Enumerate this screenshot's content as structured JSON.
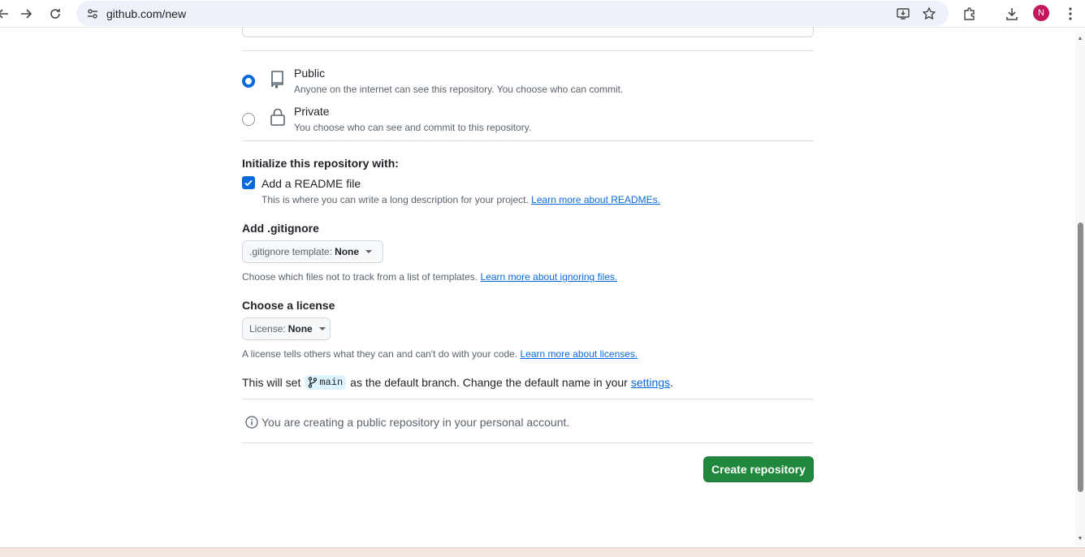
{
  "browser": {
    "url": "github.com/new",
    "avatar_letter": "N"
  },
  "visibility": {
    "public": {
      "title": "Public",
      "description": "Anyone on the internet can see this repository. You choose who can commit.",
      "selected": true
    },
    "private": {
      "title": "Private",
      "description": "You choose who can see and commit to this repository.",
      "selected": false
    }
  },
  "initialize": {
    "heading": "Initialize this repository with:",
    "readme_label": "Add a README file",
    "readme_checked": true,
    "readme_note": "This is where you can write a long description for your project.",
    "readme_link": "Learn more about READMEs."
  },
  "gitignore": {
    "heading": "Add .gitignore",
    "select_prefix": ".gitignore template:",
    "select_value": "None",
    "note": "Choose which files not to track from a list of templates.",
    "link": "Learn more about ignoring files."
  },
  "license": {
    "heading": "Choose a license",
    "select_prefix": "License:",
    "select_value": "None",
    "note": "A license tells others what they can and can't do with your code.",
    "link": "Learn more about licenses."
  },
  "branch": {
    "text_before": "This will set",
    "branch_name": "main",
    "text_after": "as the default branch. Change the default name in your",
    "link": "settings",
    "period": "."
  },
  "info": {
    "message": "You are creating a public repository in your personal account."
  },
  "actions": {
    "create_label": "Create repository"
  },
  "colors": {
    "primary_button": "#1f883d",
    "link": "#0969da",
    "accent": "#0969da"
  }
}
